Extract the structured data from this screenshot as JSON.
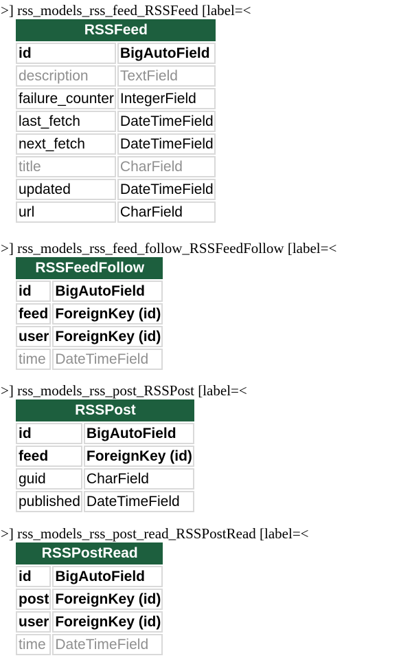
{
  "blocks": [
    {
      "caption": ">] rss_models_rss_feed_RSSFeed [label=<",
      "title": "RSSFeed",
      "fields": [
        {
          "name": "id",
          "type": "BigAutoField",
          "kind": "pk"
        },
        {
          "name": "description",
          "type": "TextField",
          "kind": "muted"
        },
        {
          "name": "failure_counter",
          "type": "IntegerField",
          "kind": "normal"
        },
        {
          "name": "last_fetch",
          "type": "DateTimeField",
          "kind": "normal"
        },
        {
          "name": "next_fetch",
          "type": "DateTimeField",
          "kind": "normal"
        },
        {
          "name": "title",
          "type": "CharField",
          "kind": "muted"
        },
        {
          "name": "updated",
          "type": "DateTimeField",
          "kind": "normal"
        },
        {
          "name": "url",
          "type": "CharField",
          "kind": "normal"
        }
      ]
    },
    {
      "caption": ">] rss_models_rss_feed_follow_RSSFeedFollow [label=<",
      "title": "RSSFeedFollow",
      "fields": [
        {
          "name": "id",
          "type": "BigAutoField",
          "kind": "pk"
        },
        {
          "name": "feed",
          "type": "ForeignKey (id)",
          "kind": "fk"
        },
        {
          "name": "user",
          "type": "ForeignKey (id)",
          "kind": "fk"
        },
        {
          "name": "time",
          "type": "DateTimeField",
          "kind": "muted"
        }
      ]
    },
    {
      "caption": ">] rss_models_rss_post_RSSPost [label=<",
      "title": "RSSPost",
      "fields": [
        {
          "name": "id",
          "type": "BigAutoField",
          "kind": "pk"
        },
        {
          "name": "feed",
          "type": "ForeignKey (id)",
          "kind": "fk"
        },
        {
          "name": "guid",
          "type": "CharField",
          "kind": "normal"
        },
        {
          "name": "published",
          "type": "DateTimeField",
          "kind": "normal"
        }
      ]
    },
    {
      "caption": ">] rss_models_rss_post_read_RSSPostRead [label=<",
      "title": "RSSPostRead",
      "fields": [
        {
          "name": "id",
          "type": "BigAutoField",
          "kind": "pk"
        },
        {
          "name": "post",
          "type": "ForeignKey (id)",
          "kind": "fk"
        },
        {
          "name": "user",
          "type": "ForeignKey (id)",
          "kind": "fk"
        },
        {
          "name": "time",
          "type": "DateTimeField",
          "kind": "muted"
        }
      ]
    }
  ]
}
